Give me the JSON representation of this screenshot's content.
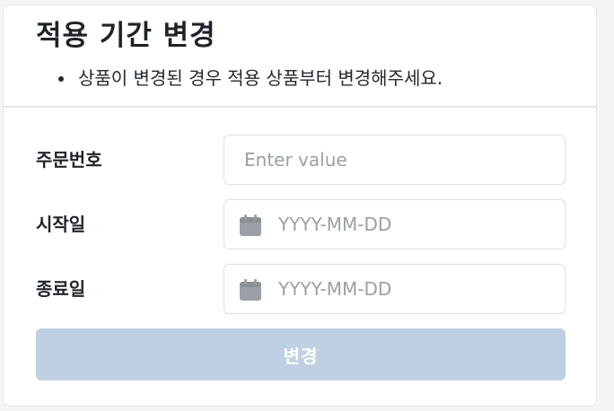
{
  "dialog": {
    "title": "적용 기간 변경",
    "notices": [
      "상품이 변경된 경우 적용 상품부터 변경해주세요."
    ]
  },
  "form": {
    "order_number": {
      "label": "주문번호",
      "placeholder": "Enter value",
      "value": ""
    },
    "start_date": {
      "label": "시작일",
      "placeholder": "YYYY-MM-DD",
      "value": "",
      "icon": "calendar-icon"
    },
    "end_date": {
      "label": "종료일",
      "placeholder": "YYYY-MM-DD",
      "value": "",
      "icon": "calendar-icon"
    }
  },
  "actions": {
    "submit_label": "변경"
  },
  "colors": {
    "submit_disabled_bg": "#bfd0e2",
    "icon_gray": "#9aa0a6",
    "border": "#dcdfe4"
  }
}
